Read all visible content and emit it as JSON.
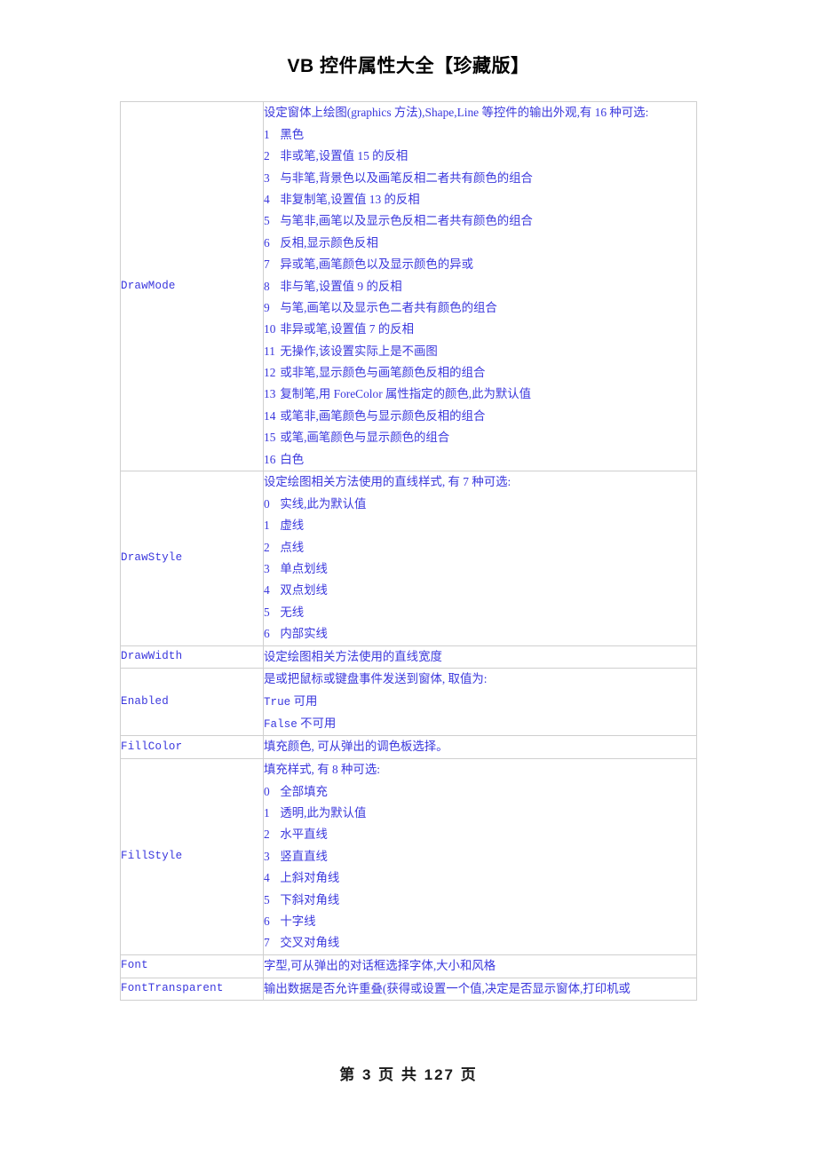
{
  "document": {
    "title": "VB 控件属性大全【珍藏版】",
    "text_color": "#3a37dd",
    "border_color": "#cfcfcf",
    "footer": "第 3 页 共 127 页"
  },
  "table": {
    "rows": [
      {
        "name": "DrawMode",
        "desc": "设定窗体上绘图(graphics 方法),Shape,Line 等控件的输出外观,有 16 种可选:",
        "options": [
          {
            "key": "1",
            "text": "黑色"
          },
          {
            "key": "2",
            "text": "非或笔,设置值 15 的反相"
          },
          {
            "key": "3",
            "text": "与非笔,背景色以及画笔反相二者共有颜色的组合"
          },
          {
            "key": "4",
            "text": "非复制笔,设置值 13 的反相"
          },
          {
            "key": "5",
            "text": "与笔非,画笔以及显示色反相二者共有颜色的组合"
          },
          {
            "key": "6",
            "text": "反相,显示颜色反相"
          },
          {
            "key": "7",
            "text": "异或笔,画笔颜色以及显示颜色的异或"
          },
          {
            "key": "8",
            "text": "非与笔,设置值 9 的反相"
          },
          {
            "key": "9",
            "text": "与笔,画笔以及显示色二者共有颜色的组合"
          },
          {
            "key": "10",
            "text": "非异或笔,设置值 7 的反相"
          },
          {
            "key": "11",
            "text": "无操作,该设置实际上是不画图"
          },
          {
            "key": "12",
            "text": "或非笔,显示颜色与画笔颜色反相的组合"
          },
          {
            "key": "13",
            "text": "复制笔,用 ForeColor 属性指定的颜色,此为默认值"
          },
          {
            "key": "14",
            "text": "或笔非,画笔颜色与显示颜色反相的组合"
          },
          {
            "key": "15",
            "text": "或笔,画笔颜色与显示颜色的组合"
          },
          {
            "key": "16",
            "text": "白色"
          }
        ]
      },
      {
        "name": "DrawStyle",
        "desc": "设定绘图相关方法使用的直线样式, 有 7 种可选:",
        "options": [
          {
            "key": "0",
            "text": "实线,此为默认值"
          },
          {
            "key": "1",
            "text": "虚线"
          },
          {
            "key": "2",
            "text": "点线"
          },
          {
            "key": "3",
            "text": "单点划线"
          },
          {
            "key": "4",
            "text": "双点划线"
          },
          {
            "key": "5",
            "text": "无线"
          },
          {
            "key": "6",
            "text": "内部实线"
          }
        ]
      },
      {
        "name": "DrawWidth",
        "desc": "设定绘图相关方法使用的直线宽度",
        "options": []
      },
      {
        "name": "Enabled",
        "desc": "是或把鼠标或键盘事件发送到窗体, 取值为:",
        "options": [
          {
            "key": "True",
            "text": "可用"
          },
          {
            "key": "False",
            "text": "不可用"
          }
        ]
      },
      {
        "name": "FillColor",
        "desc": "填充颜色, 可从弹出的调色板选择。",
        "options": []
      },
      {
        "name": "FillStyle",
        "desc": "填充样式, 有 8 种可选:",
        "options": [
          {
            "key": "0",
            "text": "全部填充"
          },
          {
            "key": "1",
            "text": "透明,此为默认值"
          },
          {
            "key": "2",
            "text": "水平直线"
          },
          {
            "key": "3",
            "text": "竖直直线"
          },
          {
            "key": "4",
            "text": "上斜对角线"
          },
          {
            "key": "5",
            "text": "下斜对角线"
          },
          {
            "key": "6",
            "text": "十字线"
          },
          {
            "key": "7",
            "text": "交叉对角线"
          }
        ]
      },
      {
        "name": "Font",
        "desc": "字型,可从弹出的对话框选择字体,大小和风格",
        "options": []
      },
      {
        "name": "FontTransparent",
        "desc": "输出数据是否允许重叠(获得或设置一个值,决定是否显示窗体,打印机或",
        "options": []
      }
    ]
  }
}
